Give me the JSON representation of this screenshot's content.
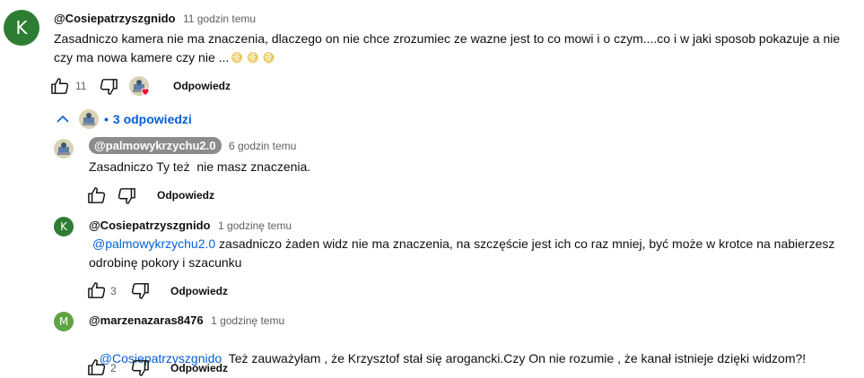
{
  "comment": {
    "avatar_letter": "K",
    "avatar_color": "#2e7d32",
    "author": "@Cosiepatrzyszgnido",
    "time": "11 godzin temu",
    "text_line1": "Zasadniczo kamera nie ma znaczenia, dlaczego on nie chce zrozumiec ze wazne jest to co mowi i o czym....co i w jaki sposob pokazuje a nie",
    "text_line2": "czy ma nowa kamere czy nie ...",
    "emojis": "😅 😅 😅",
    "likes": "11",
    "reply_label": "Odpowiedz",
    "heart_icon": "heart-icon",
    "heart_color": "#ff0033"
  },
  "replies_toggle": {
    "label": "3 odpowiedzi",
    "bullet": "•"
  },
  "replies": [
    {
      "author": "@palmowykrzychu2.0",
      "time": "6 godzin temu",
      "text": "Zasadniczo Ty też  nie masz znaczenia.",
      "likes": "",
      "reply_label": "Odpowiedz"
    },
    {
      "avatar_letter": "K",
      "avatar_color": "#2e7d32",
      "author": "@Cosiepatrzyszgnido",
      "time": "1 godzinę temu",
      "mention": "@palmowykrzychu2.0",
      "text_line1": " zasadniczo żaden widz nie ma znaczenia, na szczęście jest ich co raz mniej, być może w krotce na nabierzesz",
      "text_line2": "odrobinę pokory i szacunku",
      "likes": "3",
      "reply_label": "Odpowiedz"
    },
    {
      "avatar_letter": "M",
      "avatar_color": "#5fa342",
      "author": "@marzenazaras8476",
      "time": "1 godzinę temu",
      "mention": "@Cosiepatrzyszgnido",
      "text": "  Też zauważyłam , że Krzysztof stał się arogancki.Czy On nie rozumie , że kanał istnieje dzięki widzom?!",
      "likes": "2",
      "reply_label": "Odpowiedz"
    }
  ]
}
